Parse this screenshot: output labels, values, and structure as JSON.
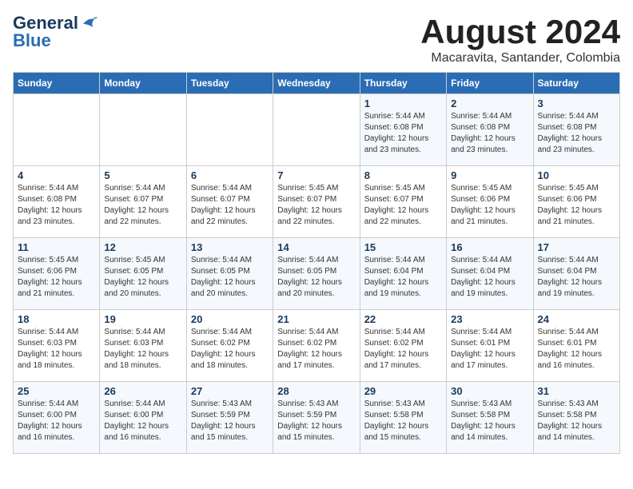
{
  "header": {
    "logo_line1": "General",
    "logo_line2": "Blue",
    "month": "August 2024",
    "location": "Macaravita, Santander, Colombia"
  },
  "days_of_week": [
    "Sunday",
    "Monday",
    "Tuesday",
    "Wednesday",
    "Thursday",
    "Friday",
    "Saturday"
  ],
  "weeks": [
    [
      {
        "day": "",
        "info": ""
      },
      {
        "day": "",
        "info": ""
      },
      {
        "day": "",
        "info": ""
      },
      {
        "day": "",
        "info": ""
      },
      {
        "day": "1",
        "info": "Sunrise: 5:44 AM\nSunset: 6:08 PM\nDaylight: 12 hours\nand 23 minutes."
      },
      {
        "day": "2",
        "info": "Sunrise: 5:44 AM\nSunset: 6:08 PM\nDaylight: 12 hours\nand 23 minutes."
      },
      {
        "day": "3",
        "info": "Sunrise: 5:44 AM\nSunset: 6:08 PM\nDaylight: 12 hours\nand 23 minutes."
      }
    ],
    [
      {
        "day": "4",
        "info": "Sunrise: 5:44 AM\nSunset: 6:08 PM\nDaylight: 12 hours\nand 23 minutes."
      },
      {
        "day": "5",
        "info": "Sunrise: 5:44 AM\nSunset: 6:07 PM\nDaylight: 12 hours\nand 22 minutes."
      },
      {
        "day": "6",
        "info": "Sunrise: 5:44 AM\nSunset: 6:07 PM\nDaylight: 12 hours\nand 22 minutes."
      },
      {
        "day": "7",
        "info": "Sunrise: 5:45 AM\nSunset: 6:07 PM\nDaylight: 12 hours\nand 22 minutes."
      },
      {
        "day": "8",
        "info": "Sunrise: 5:45 AM\nSunset: 6:07 PM\nDaylight: 12 hours\nand 22 minutes."
      },
      {
        "day": "9",
        "info": "Sunrise: 5:45 AM\nSunset: 6:06 PM\nDaylight: 12 hours\nand 21 minutes."
      },
      {
        "day": "10",
        "info": "Sunrise: 5:45 AM\nSunset: 6:06 PM\nDaylight: 12 hours\nand 21 minutes."
      }
    ],
    [
      {
        "day": "11",
        "info": "Sunrise: 5:45 AM\nSunset: 6:06 PM\nDaylight: 12 hours\nand 21 minutes."
      },
      {
        "day": "12",
        "info": "Sunrise: 5:45 AM\nSunset: 6:05 PM\nDaylight: 12 hours\nand 20 minutes."
      },
      {
        "day": "13",
        "info": "Sunrise: 5:44 AM\nSunset: 6:05 PM\nDaylight: 12 hours\nand 20 minutes."
      },
      {
        "day": "14",
        "info": "Sunrise: 5:44 AM\nSunset: 6:05 PM\nDaylight: 12 hours\nand 20 minutes."
      },
      {
        "day": "15",
        "info": "Sunrise: 5:44 AM\nSunset: 6:04 PM\nDaylight: 12 hours\nand 19 minutes."
      },
      {
        "day": "16",
        "info": "Sunrise: 5:44 AM\nSunset: 6:04 PM\nDaylight: 12 hours\nand 19 minutes."
      },
      {
        "day": "17",
        "info": "Sunrise: 5:44 AM\nSunset: 6:04 PM\nDaylight: 12 hours\nand 19 minutes."
      }
    ],
    [
      {
        "day": "18",
        "info": "Sunrise: 5:44 AM\nSunset: 6:03 PM\nDaylight: 12 hours\nand 18 minutes."
      },
      {
        "day": "19",
        "info": "Sunrise: 5:44 AM\nSunset: 6:03 PM\nDaylight: 12 hours\nand 18 minutes."
      },
      {
        "day": "20",
        "info": "Sunrise: 5:44 AM\nSunset: 6:02 PM\nDaylight: 12 hours\nand 18 minutes."
      },
      {
        "day": "21",
        "info": "Sunrise: 5:44 AM\nSunset: 6:02 PM\nDaylight: 12 hours\nand 17 minutes."
      },
      {
        "day": "22",
        "info": "Sunrise: 5:44 AM\nSunset: 6:02 PM\nDaylight: 12 hours\nand 17 minutes."
      },
      {
        "day": "23",
        "info": "Sunrise: 5:44 AM\nSunset: 6:01 PM\nDaylight: 12 hours\nand 17 minutes."
      },
      {
        "day": "24",
        "info": "Sunrise: 5:44 AM\nSunset: 6:01 PM\nDaylight: 12 hours\nand 16 minutes."
      }
    ],
    [
      {
        "day": "25",
        "info": "Sunrise: 5:44 AM\nSunset: 6:00 PM\nDaylight: 12 hours\nand 16 minutes."
      },
      {
        "day": "26",
        "info": "Sunrise: 5:44 AM\nSunset: 6:00 PM\nDaylight: 12 hours\nand 16 minutes."
      },
      {
        "day": "27",
        "info": "Sunrise: 5:43 AM\nSunset: 5:59 PM\nDaylight: 12 hours\nand 15 minutes."
      },
      {
        "day": "28",
        "info": "Sunrise: 5:43 AM\nSunset: 5:59 PM\nDaylight: 12 hours\nand 15 minutes."
      },
      {
        "day": "29",
        "info": "Sunrise: 5:43 AM\nSunset: 5:58 PM\nDaylight: 12 hours\nand 15 minutes."
      },
      {
        "day": "30",
        "info": "Sunrise: 5:43 AM\nSunset: 5:58 PM\nDaylight: 12 hours\nand 14 minutes."
      },
      {
        "day": "31",
        "info": "Sunrise: 5:43 AM\nSunset: 5:58 PM\nDaylight: 12 hours\nand 14 minutes."
      }
    ]
  ]
}
